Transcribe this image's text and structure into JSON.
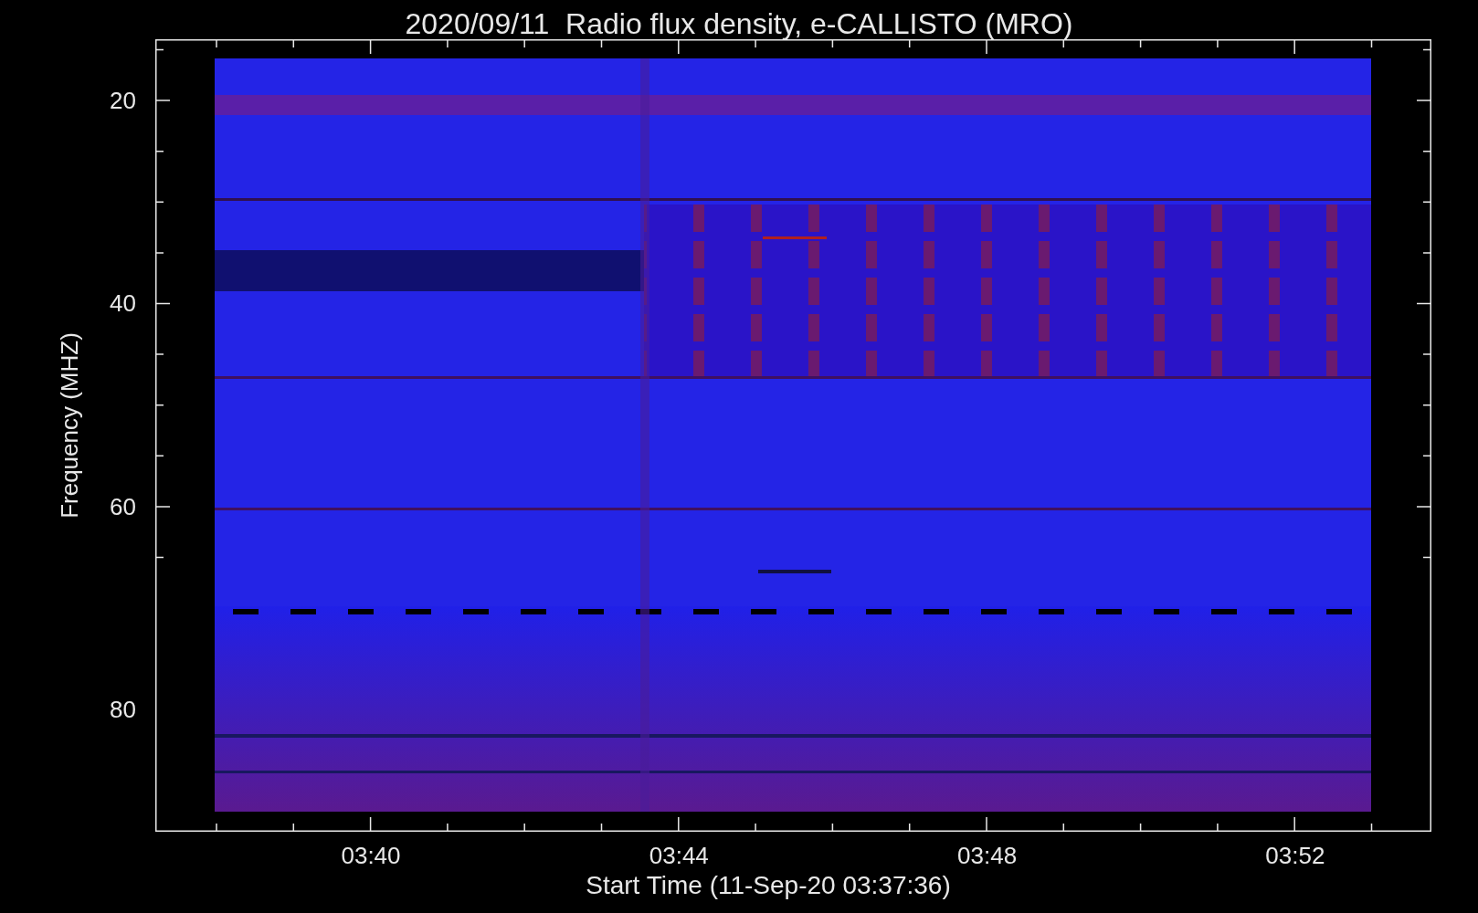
{
  "title": "2020/09/11  Radio flux density, e-CALLISTO (MRO)",
  "y_axis": {
    "label": "Frequency (MHZ)",
    "ticks": [
      "20",
      "40",
      "60",
      "80"
    ]
  },
  "x_axis": {
    "label": "Start Time (11-Sep-20 03:37:36)",
    "ticks": [
      "03:40",
      "03:44",
      "03:48",
      "03:52"
    ]
  }
}
